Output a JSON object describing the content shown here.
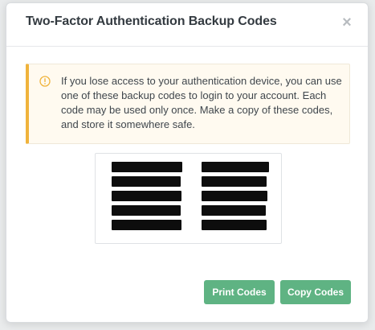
{
  "dialog": {
    "title": "Two-Factor Authentication Backup Codes",
    "close_icon": "close-icon"
  },
  "alert": {
    "icon": "info-circle-icon",
    "color": "#f0b33b",
    "text": "If you lose access to your authentication device, you can use one of these backup codes to login to your account. Each code may be used only once. Make a copy of these codes, and store it somewhere safe."
  },
  "codes": {
    "left": [
      "",
      "",
      "",
      "",
      ""
    ],
    "right": [
      "",
      "",
      "",
      "",
      ""
    ]
  },
  "buttons": {
    "print_label": "Print Codes",
    "copy_label": "Copy Codes",
    "color": "#5fb383"
  }
}
